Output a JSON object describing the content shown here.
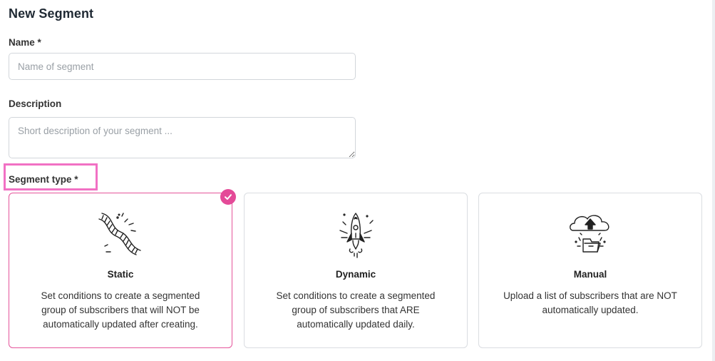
{
  "page": {
    "title": "New Segment"
  },
  "form": {
    "name": {
      "label": "Name *",
      "placeholder": "Name of segment",
      "value": ""
    },
    "description": {
      "label": "Description",
      "placeholder": "Short description of your segment ...",
      "value": ""
    },
    "segment_type": {
      "label": "Segment type *",
      "selected": "static",
      "options": [
        {
          "id": "static",
          "title": "Static",
          "description": "Set conditions to create a segmented group of subscribers that will NOT be automatically updated after creating.",
          "icon": "dna-icon"
        },
        {
          "id": "dynamic",
          "title": "Dynamic",
          "description": "Set conditions to create a segmented group of subscribers that ARE automatically updated daily.",
          "icon": "rocket-icon"
        },
        {
          "id": "manual",
          "title": "Manual",
          "description": "Upload a list of subscribers that are NOT automatically updated.",
          "icon": "cloud-upload-icon"
        }
      ]
    }
  },
  "colors": {
    "accent": "#e44a98",
    "highlight_border": "#f171c4",
    "card_border": "#dadde1"
  }
}
